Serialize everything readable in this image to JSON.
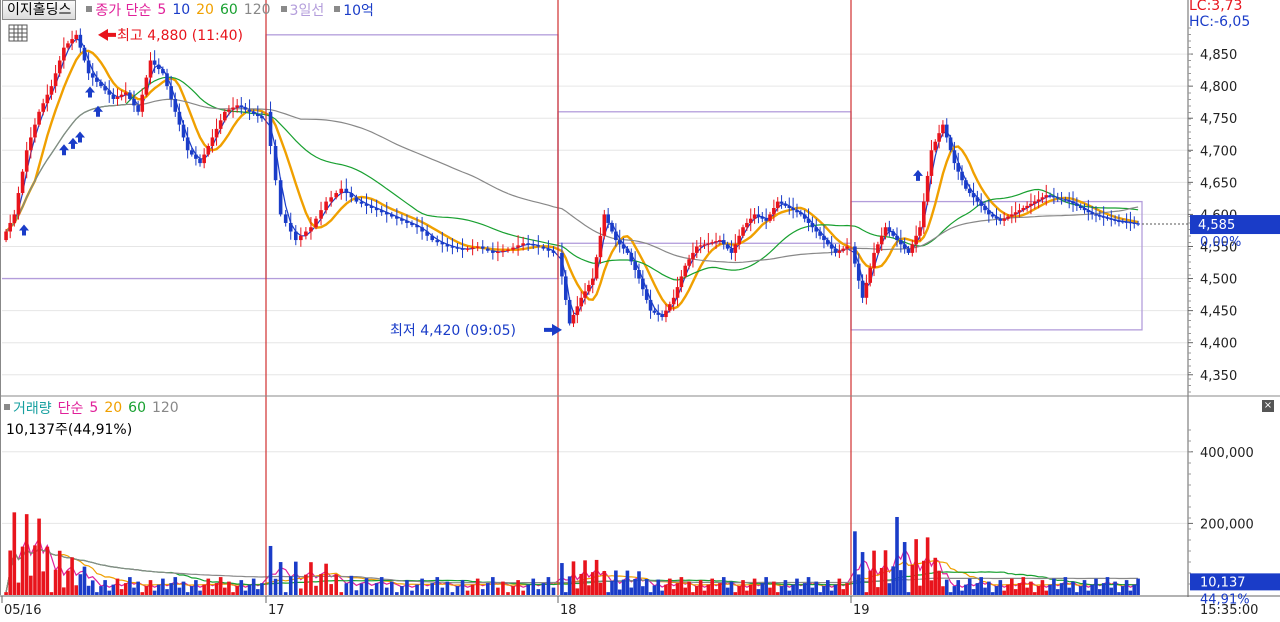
{
  "header": {
    "stock_name": "이지홀딩스",
    "price_title": "종가 단순",
    "ma_periods": [
      "5",
      "10",
      "20",
      "60",
      "120"
    ],
    "ma_colors": [
      "#e0209a",
      "#1a3cc8",
      "#f0a000",
      "#18a030",
      "#888888"
    ],
    "band_label": "3일선",
    "band_color": "#b39ddb",
    "unit_label": "10억",
    "lc": "LC:3,73",
    "hc": "HC:-6,05"
  },
  "volume_header": {
    "title": "거래량",
    "ma_title": "단순",
    "ma_periods": [
      "5",
      "20",
      "60",
      "120"
    ],
    "ma_colors": [
      "#e0209a",
      "#f0a000",
      "#18a030",
      "#888888"
    ],
    "current": "10,137주(44,91%)"
  },
  "price_axis": {
    "ticks": [
      "4,850",
      "4,800",
      "4,750",
      "4,700",
      "4,650",
      "4,600",
      "4,550",
      "4,500",
      "4,450",
      "4,400",
      "4,350"
    ],
    "current_price": "4,585",
    "current_pct": "0,00%"
  },
  "volume_axis": {
    "ticks": [
      "400,000",
      "200,000"
    ],
    "current_volume": "10,137",
    "current_pct": "44,91%"
  },
  "x_axis": {
    "dates": [
      "05/16",
      "17",
      "18",
      "19"
    ],
    "time": "15:35:00"
  },
  "annotations": {
    "high": "최고 4,880 (11:40)",
    "low": "최저 4,420 (09:05)"
  },
  "colors": {
    "up": "#e8141c",
    "down": "#1a3cc8",
    "divider": "#d03030",
    "axis_box": "#1a3cc8"
  },
  "chart_data": {
    "type": "candlestick",
    "price_range": [
      4320,
      4900
    ],
    "volume_range": [
      0,
      500000
    ],
    "high": 4880,
    "low": 4420,
    "last": 4585,
    "sessions": [
      {
        "date": "05/16",
        "open": 4560,
        "high": 4880,
        "low": 4480,
        "close": 4750,
        "path": [
          4560,
          4600,
          4700,
          4760,
          4800,
          4860,
          4880,
          4820,
          4800,
          4780,
          4790,
          4760,
          4840,
          4820,
          4760,
          4700,
          4680,
          4720,
          4760,
          4770,
          4760,
          4750
        ]
      },
      {
        "date": "17",
        "open": 4760,
        "high": 4760,
        "low": 4520,
        "close": 4540,
        "path": [
          4760,
          4600,
          4560,
          4580,
          4620,
          4640,
          4620,
          4610,
          4600,
          4590,
          4580,
          4560,
          4550,
          4545,
          4550,
          4540,
          4545,
          4555,
          4550,
          4540
        ]
      },
      {
        "date": "18",
        "open": 4540,
        "high": 4620,
        "low": 4420,
        "close": 4600,
        "path": [
          4540,
          4430,
          4470,
          4500,
          4600,
          4560,
          4540,
          4500,
          4450,
          4440,
          4470,
          4520,
          4550,
          4555,
          4560,
          4540,
          4580,
          4600,
          4590,
          4620,
          4610,
          4600,
          4580,
          4560,
          4540,
          4550
        ]
      },
      {
        "date": "19",
        "open": 4550,
        "high": 4750,
        "low": 4460,
        "close": 4585,
        "path": [
          4550,
          4470,
          4540,
          4580,
          4560,
          4540,
          4580,
          4700,
          4740,
          4680,
          4640,
          4620,
          4600,
          4590,
          4600,
          4610,
          4620,
          4630,
          4625,
          4620,
          4610,
          4600,
          4595,
          4590,
          4588,
          4585
        ]
      }
    ],
    "band": [
      {
        "session": "05/16",
        "high": 4880,
        "low": 4500
      },
      {
        "session": "17",
        "high": 4760,
        "low": 4555
      },
      {
        "session": "18",
        "high": 4620,
        "low": 4420
      },
      {
        "session": "19",
        "high": 4750,
        "low": 4555
      }
    ],
    "volume_peaks": [
      {
        "session": "05/16",
        "value": 390000
      },
      {
        "session": "17",
        "value": 130000
      },
      {
        "session": "18",
        "value": 110000
      },
      {
        "session": "19",
        "value": 190000
      }
    ]
  }
}
